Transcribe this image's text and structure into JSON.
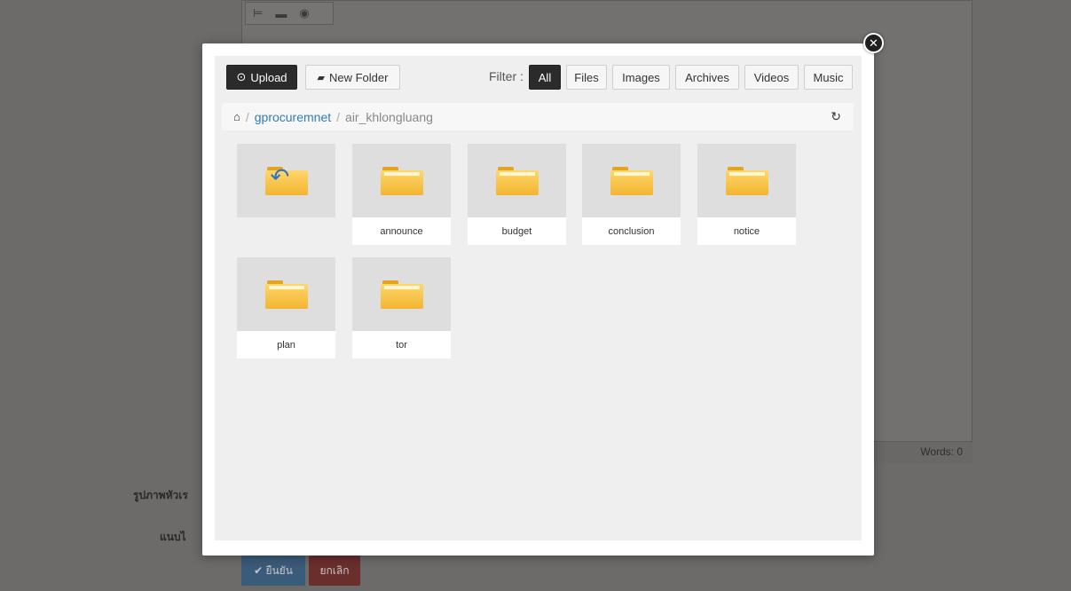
{
  "background": {
    "toolbar_icons": [
      "line-icon",
      "print-icon",
      "preview-icon"
    ],
    "status_words": "Words: 0",
    "labels": [
      "รูปภาพหัวเร",
      "แนบไ"
    ],
    "confirm_label": "✔ ยืนยัน",
    "cancel_label": "ยกเลิก"
  },
  "modal": {
    "close_glyph": "✕",
    "toolbar": {
      "upload_label": "Upload",
      "new_folder_label": "New Folder",
      "filter_label": "Filter :",
      "filters": [
        "All",
        "Files",
        "Images",
        "Archives",
        "Videos",
        "Music"
      ],
      "active_filter": "All"
    },
    "breadcrumb": {
      "root": "gprocuremnet",
      "current": "air_khlongluang"
    },
    "folders": [
      "announce",
      "budget",
      "conclusion",
      "notice",
      "plan",
      "tor"
    ]
  },
  "colors": {
    "link": "#2f7db8",
    "active_filter": "#2b2b2b",
    "folder": "#f2b531"
  }
}
